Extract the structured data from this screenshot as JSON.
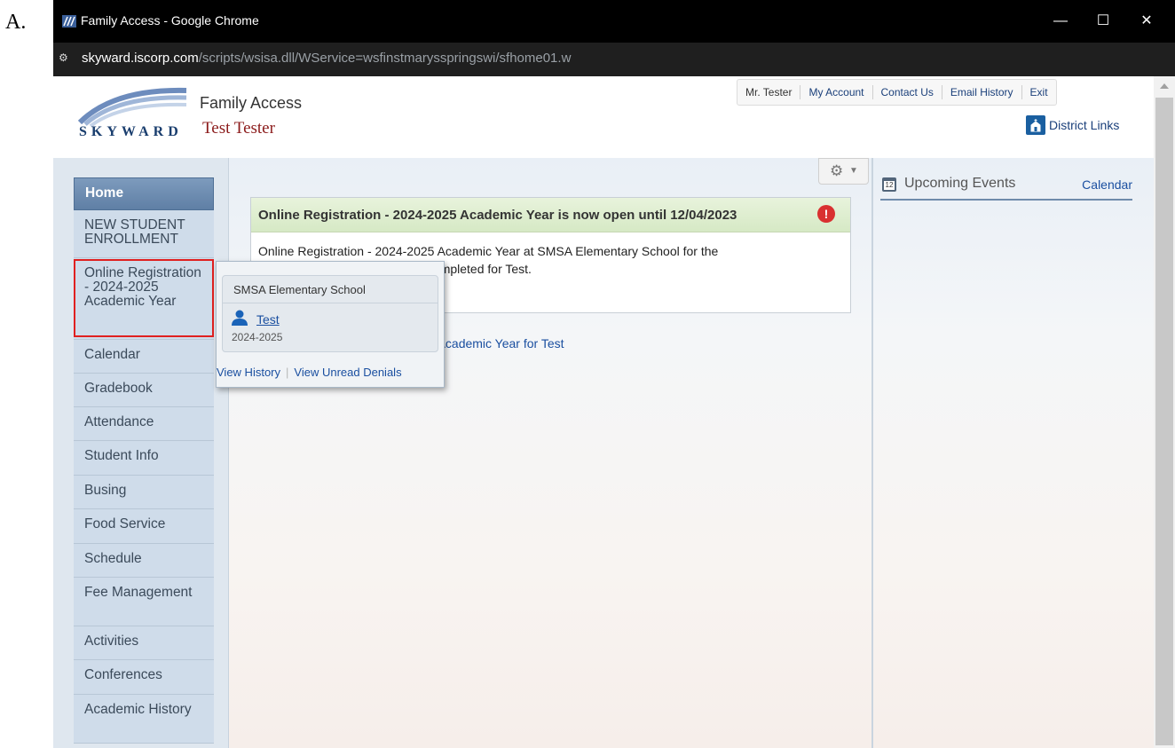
{
  "outer_label": "A.",
  "window": {
    "title": "Family Access - Google Chrome",
    "url_host": "skyward.iscorp.com",
    "url_path": "/scripts/wsisa.dll/WService=wsfinstmarysspringswi/sfhome01.w"
  },
  "header": {
    "logo_text": "SKYWARD",
    "app_title": "Family Access",
    "user_name": "Test Tester",
    "nav": [
      "Mr. Tester",
      "My Account",
      "Contact Us",
      "Email History",
      "Exit"
    ],
    "district_links": "District Links"
  },
  "sidebar": {
    "items": [
      {
        "label": "Home"
      },
      {
        "label": "NEW STUDENT ENROLLMENT"
      },
      {
        "label": "Online Registration - 2024-2025 Academic Year"
      },
      {
        "label": "Calendar"
      },
      {
        "label": "Gradebook"
      },
      {
        "label": "Attendance"
      },
      {
        "label": "Student Info"
      },
      {
        "label": "Busing"
      },
      {
        "label": "Food Service"
      },
      {
        "label": "Schedule"
      },
      {
        "label": "Fee Management"
      },
      {
        "label": "Activities"
      },
      {
        "label": "Conferences"
      },
      {
        "label": "Academic History"
      }
    ]
  },
  "message": {
    "heading": "Online Registration - 2024-2025 Academic Year is now open until 12/04/2023",
    "body_line1": "Online Registration - 2024-2025 Academic Year at SMSA Elementary School for the",
    "body_line2": "is now open, yet has not been completed for Test.",
    "link": "Online Registration - 2024-2025 Academic Year for Test",
    "alert_glyph": "!"
  },
  "popup": {
    "school": "SMSA Elementary School",
    "student": "Test",
    "year": "2024-2025",
    "view_history": "View History",
    "separator": "|",
    "view_unread_denials": "View Unread Denials"
  },
  "right_panel": {
    "title": "Upcoming Events",
    "calendar_link": "Calendar",
    "calendar_icon_day": "12"
  },
  "icons": {
    "gear": "gear-icon",
    "alert": "alert-icon",
    "person": "person-icon",
    "calendar": "calendar-icon",
    "church": "district-icon"
  }
}
